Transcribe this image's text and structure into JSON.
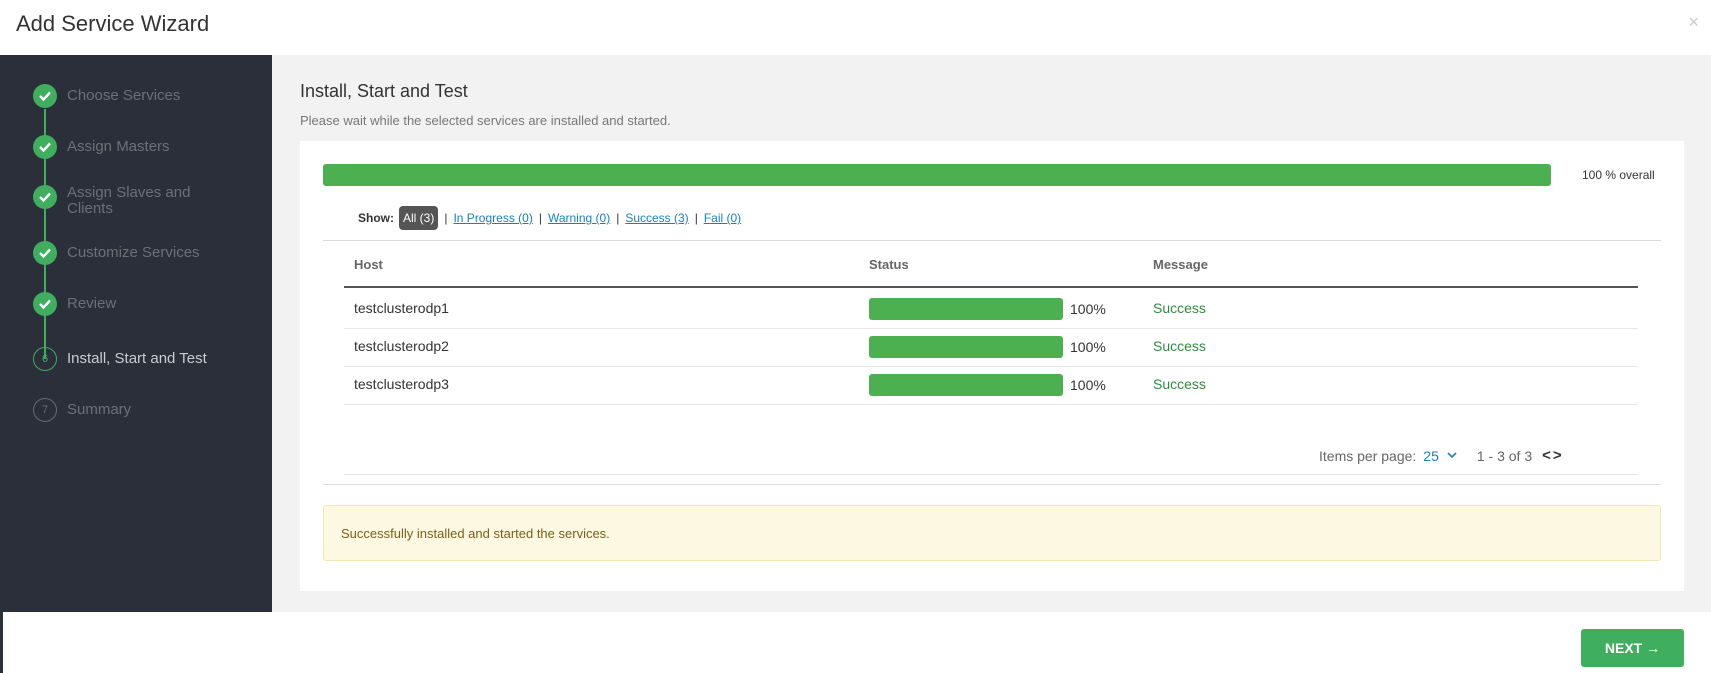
{
  "header": {
    "title": "Add Service Wizard",
    "close_glyph": "×"
  },
  "steps": [
    {
      "label": "Choose Services",
      "state": "done",
      "marker": "✓"
    },
    {
      "label": "Assign Masters",
      "state": "done",
      "marker": "✓"
    },
    {
      "label": "Assign Slaves and Clients",
      "state": "done",
      "marker": "✓"
    },
    {
      "label": "Customize Services",
      "state": "done",
      "marker": "✓"
    },
    {
      "label": "Review",
      "state": "done",
      "marker": "✓"
    },
    {
      "label": "Install, Start and Test",
      "state": "active",
      "marker": "6"
    },
    {
      "label": "Summary",
      "state": "todo",
      "marker": "7"
    }
  ],
  "main": {
    "title": "Install, Start and Test",
    "subtitle": "Please wait while the selected services are installed and started.",
    "overall_progress": 100,
    "overall_label": "100 % overall"
  },
  "filters": {
    "show_label": "Show:",
    "all": "All (3)",
    "in_progress": "In Progress (0)",
    "warning": "Warning (0)",
    "success": "Success (3)",
    "fail": "Fail (0)",
    "separator": "|"
  },
  "table": {
    "headers": {
      "host": "Host",
      "status": "Status",
      "message": "Message"
    },
    "rows": [
      {
        "host": "testclusterodp1",
        "progress": 100,
        "percent": "100%",
        "message": "Success"
      },
      {
        "host": "testclusterodp2",
        "progress": 100,
        "percent": "100%",
        "message": "Success"
      },
      {
        "host": "testclusterodp3",
        "progress": 100,
        "percent": "100%",
        "message": "Success"
      }
    ]
  },
  "pagination": {
    "items_per_page_label": "Items per page:",
    "items_per_page": "25",
    "range": "1 - 3 of 3",
    "prev_glyph": "<",
    "next_glyph": ">"
  },
  "alert": {
    "text": "Successfully installed and started the services."
  },
  "footer": {
    "next_label": "NEXT →"
  },
  "colors": {
    "success_green": "#3fae5e",
    "sidebar_bg": "#2a2f3a",
    "link_blue": "#1b7fbd",
    "alert_bg": "#fdf8e2"
  }
}
